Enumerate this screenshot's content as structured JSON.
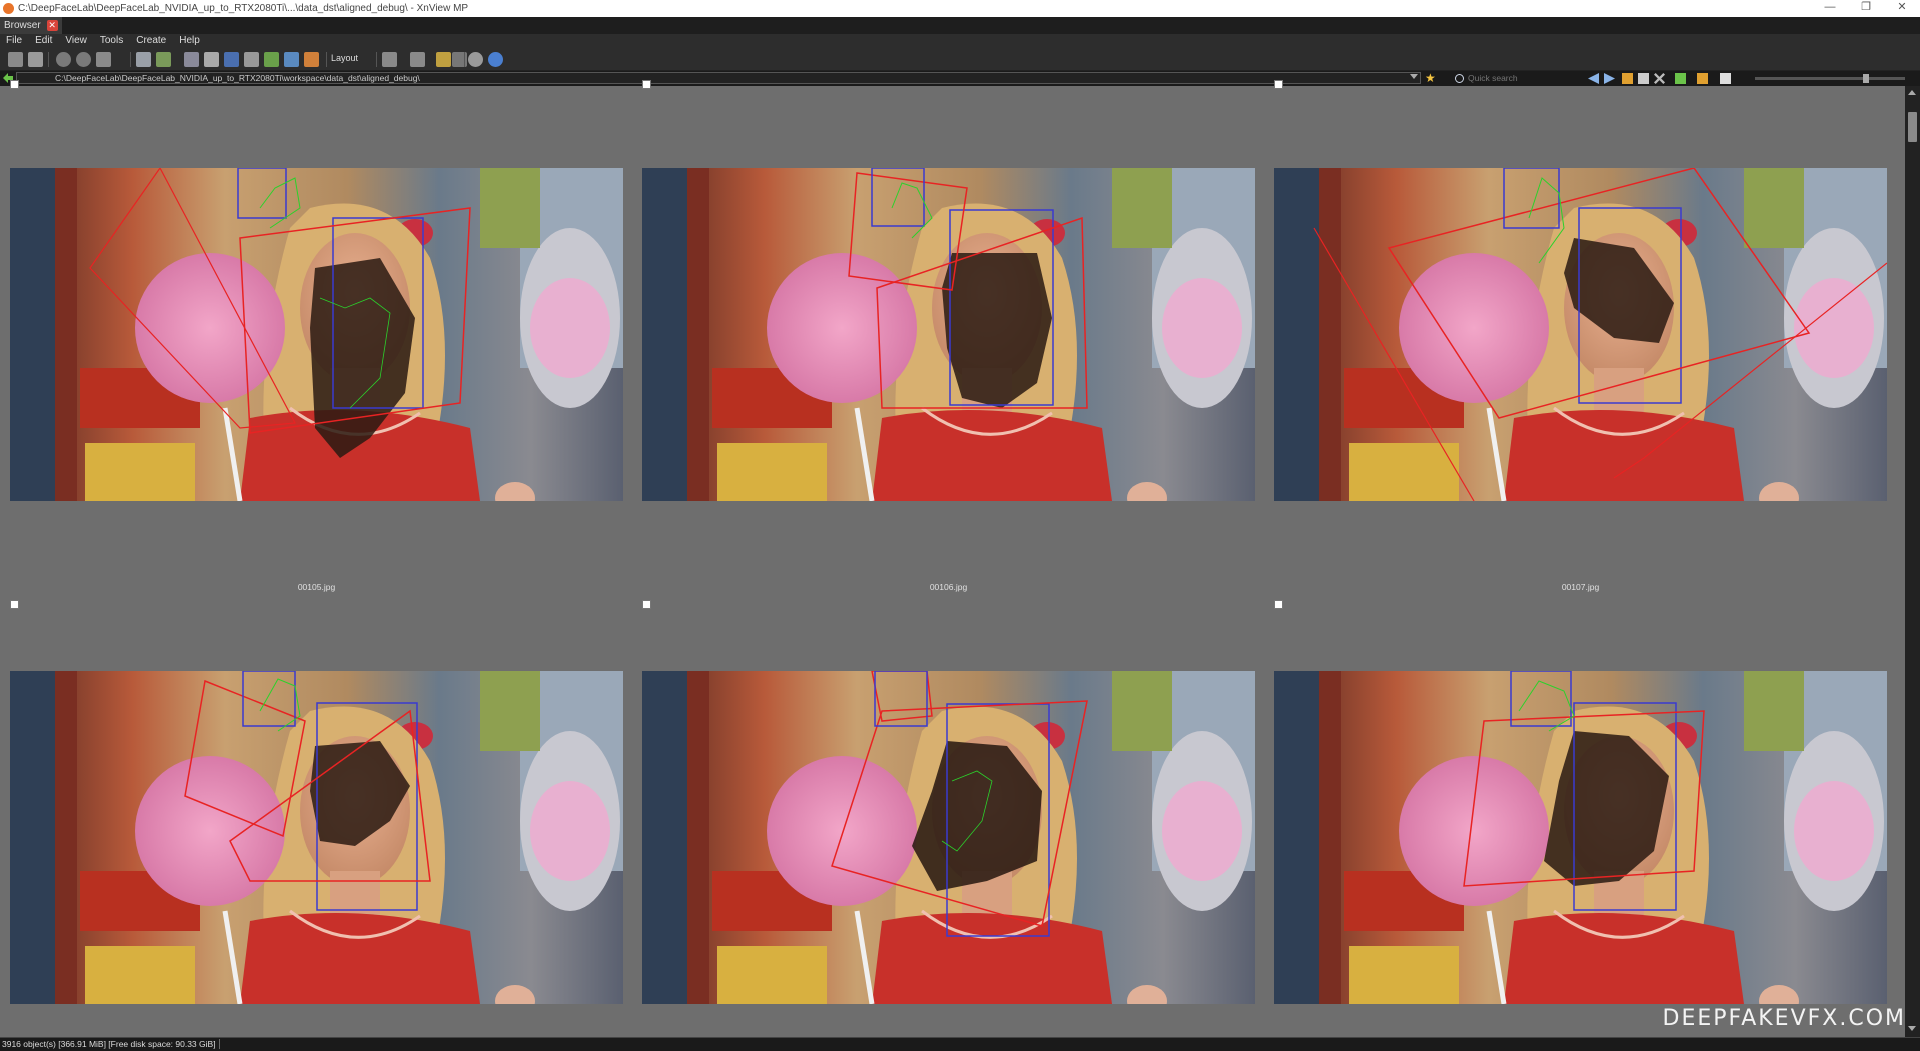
{
  "window": {
    "title": "C:\\DeepFaceLab\\DeepFaceLab_NVIDIA_up_to_RTX2080Ti\\...\\data_dst\\aligned_debug\\ - XnView MP",
    "minimize": "—",
    "restore": "❐",
    "close": "✕"
  },
  "tab": {
    "label": "Browser",
    "close": "✕"
  },
  "menu": [
    "File",
    "Edit",
    "View",
    "Tools",
    "Create",
    "Help"
  ],
  "toolbar": {
    "layout_label": "Layout"
  },
  "address": {
    "path": "C:\\DeepFaceLab\\DeepFaceLab_NVIDIA_up_to_RTX2080Ti\\workspace\\data_dst\\aligned_debug\\",
    "search_placeholder": "Quick search"
  },
  "thumbnails": [
    {
      "filename": "00105.jpg"
    },
    {
      "filename": "00106.jpg"
    },
    {
      "filename": "00107.jpg"
    },
    {
      "filename": ""
    },
    {
      "filename": ""
    },
    {
      "filename": ""
    }
  ],
  "status": {
    "text": "3916 object(s) [366.91 MiB] [Free disk space: 90.33 GiB]"
  },
  "watermark": "DEEPFAKEVFX.COM",
  "colors": {
    "landmark_box": "#e82323",
    "face_box": "#3a3acf",
    "mask": "#2a1a12",
    "landmarks": "#2bd12b",
    "background": "#6e6e6e"
  }
}
